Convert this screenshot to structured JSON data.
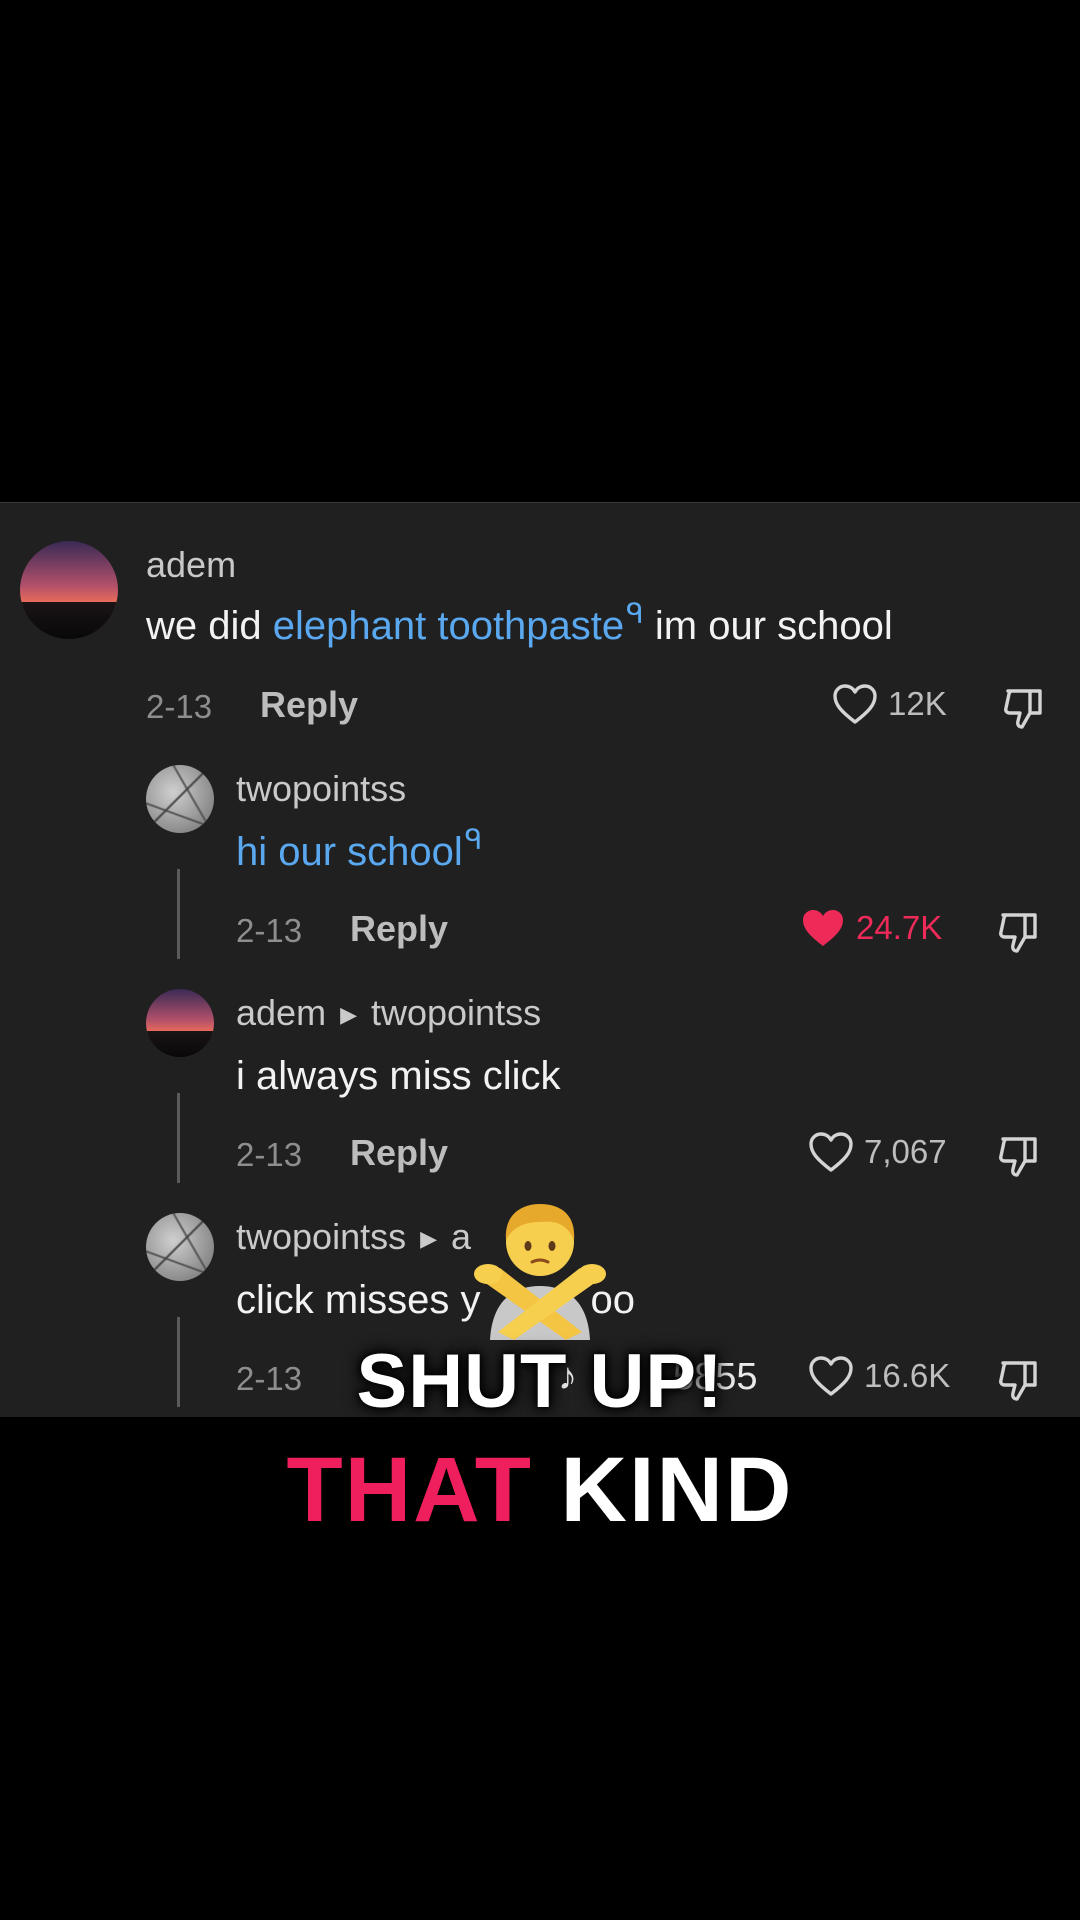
{
  "thread": {
    "comments": [
      {
        "username": "adem",
        "text_before": "we did ",
        "link_text": "elephant toothpaste",
        "search_mark": "ᑫ",
        "text_after": " im our school",
        "date": "2-13",
        "reply_label": "Reply",
        "likes": "12K",
        "liked": false
      },
      {
        "username": "twopointss",
        "link_text": "hi our school",
        "search_mark": "ᑫ",
        "date": "2-13",
        "reply_label": "Reply",
        "likes": "24.7K",
        "liked": true
      },
      {
        "username": "adem",
        "reply_to": "twopointss",
        "text": "i always miss click",
        "date": "2-13",
        "reply_label": "Reply",
        "likes": "7,067",
        "liked": false
      },
      {
        "username": "twopointss",
        "reply_to_partial": "a",
        "text_left": "click misses y",
        "text_right": "oo",
        "date": "2-13",
        "likes": "16.6K",
        "liked": false
      }
    ]
  },
  "watermark": {
    "icon": "tiktok-note-icon",
    "text": "5855"
  },
  "captions": {
    "line1": "SHUT UP!",
    "line2_highlight": "THAT",
    "line2_rest": " KIND"
  },
  "overlay": {
    "emoji": "person-gesturing-no-emoji"
  },
  "colors": {
    "panel": "#202020",
    "link": "#5aa8f0",
    "like_active": "#ee2a59",
    "caption_pink": "#ee1f5c"
  }
}
